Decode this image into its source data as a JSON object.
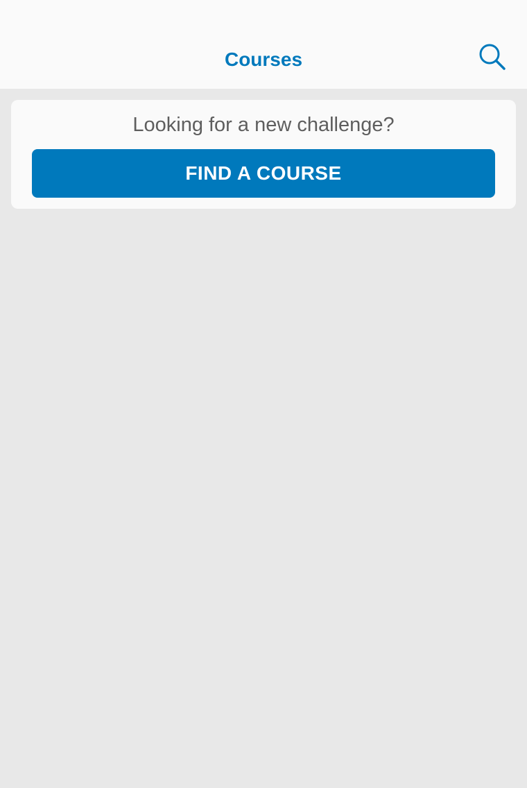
{
  "header": {
    "title": "Courses",
    "search_icon": "search-icon"
  },
  "card": {
    "prompt": "Looking for a new challenge?",
    "button_label": "FIND A COURSE"
  },
  "colors": {
    "accent": "#0079bc",
    "header_bg": "#fafafa",
    "page_bg": "#e8e8e8",
    "prompt_text": "#5e5e5e"
  }
}
